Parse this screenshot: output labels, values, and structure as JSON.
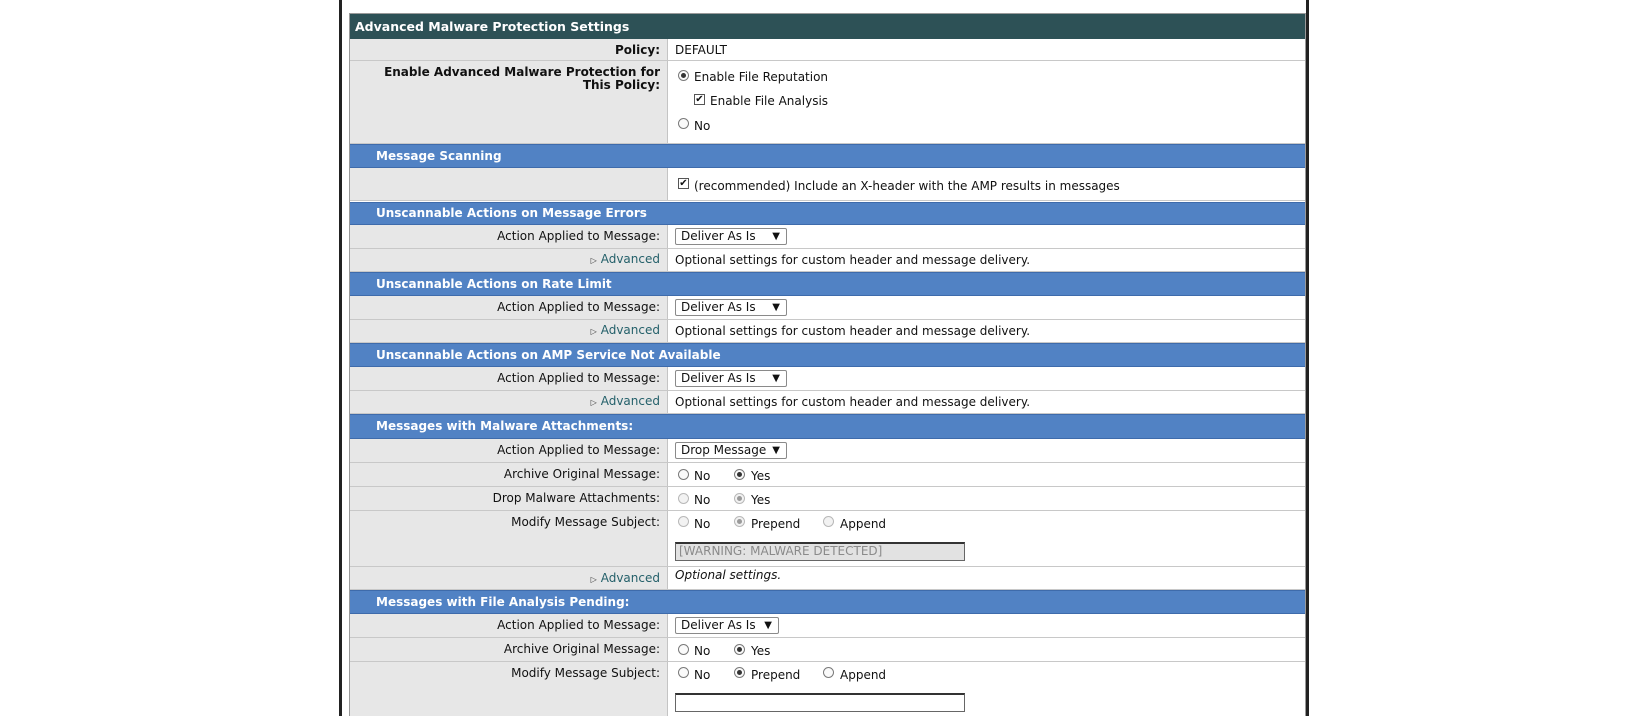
{
  "panel_title": "Advanced Malware Protection Settings",
  "policy": {
    "label": "Policy:",
    "value": "DEFAULT"
  },
  "enable_amp": {
    "label": "Enable Advanced Malware Protection for This Policy:",
    "option_file_reputation": "Enable File Reputation",
    "option_file_analysis": "Enable File Analysis",
    "option_no": "No"
  },
  "message_scanning": {
    "title": "Message Scanning",
    "xheader_label": "(recommended) Include an X-header with the AMP results in messages"
  },
  "unscannable_errors": {
    "title": "Unscannable Actions on Message Errors",
    "action_label": "Action Applied to Message:",
    "action_value": "Deliver As Is",
    "advanced_label": "Advanced",
    "advanced_desc": "Optional settings for custom header and message delivery."
  },
  "unscannable_rate": {
    "title": "Unscannable Actions on Rate Limit",
    "action_label": "Action Applied to Message:",
    "action_value": "Deliver As Is",
    "advanced_label": "Advanced",
    "advanced_desc": "Optional settings for custom header and message delivery."
  },
  "unscannable_amp": {
    "title": "Unscannable Actions on AMP Service Not Available",
    "action_label": "Action Applied to Message:",
    "action_value": "Deliver As Is",
    "advanced_label": "Advanced",
    "advanced_desc": "Optional settings for custom header and message delivery."
  },
  "malware_attachments": {
    "title": "Messages with Malware Attachments:",
    "action_label": "Action Applied to Message:",
    "action_value": "Drop Message",
    "archive_label": "Archive Original Message:",
    "drop_label": "Drop Malware Attachments:",
    "modify_label": "Modify Message Subject:",
    "opt_no": "No",
    "opt_yes": "Yes",
    "opt_prepend": "Prepend",
    "opt_append": "Append",
    "subject_text": "[WARNING: MALWARE DETECTED]",
    "advanced_label": "Advanced",
    "advanced_desc": "Optional settings."
  },
  "file_analysis_pending": {
    "title": "Messages with File Analysis Pending:",
    "action_label": "Action Applied to Message:",
    "action_value": "Deliver As Is",
    "archive_label": "Archive Original Message:",
    "modify_label": "Modify Message Subject:",
    "opt_no": "No",
    "opt_yes": "Yes",
    "opt_prepend": "Prepend",
    "opt_append": "Append"
  },
  "colors": {
    "title_bar": "#2d5156",
    "section_bar": "#5182c4",
    "label_bg": "#e7e7e7",
    "link": "#24606a"
  }
}
